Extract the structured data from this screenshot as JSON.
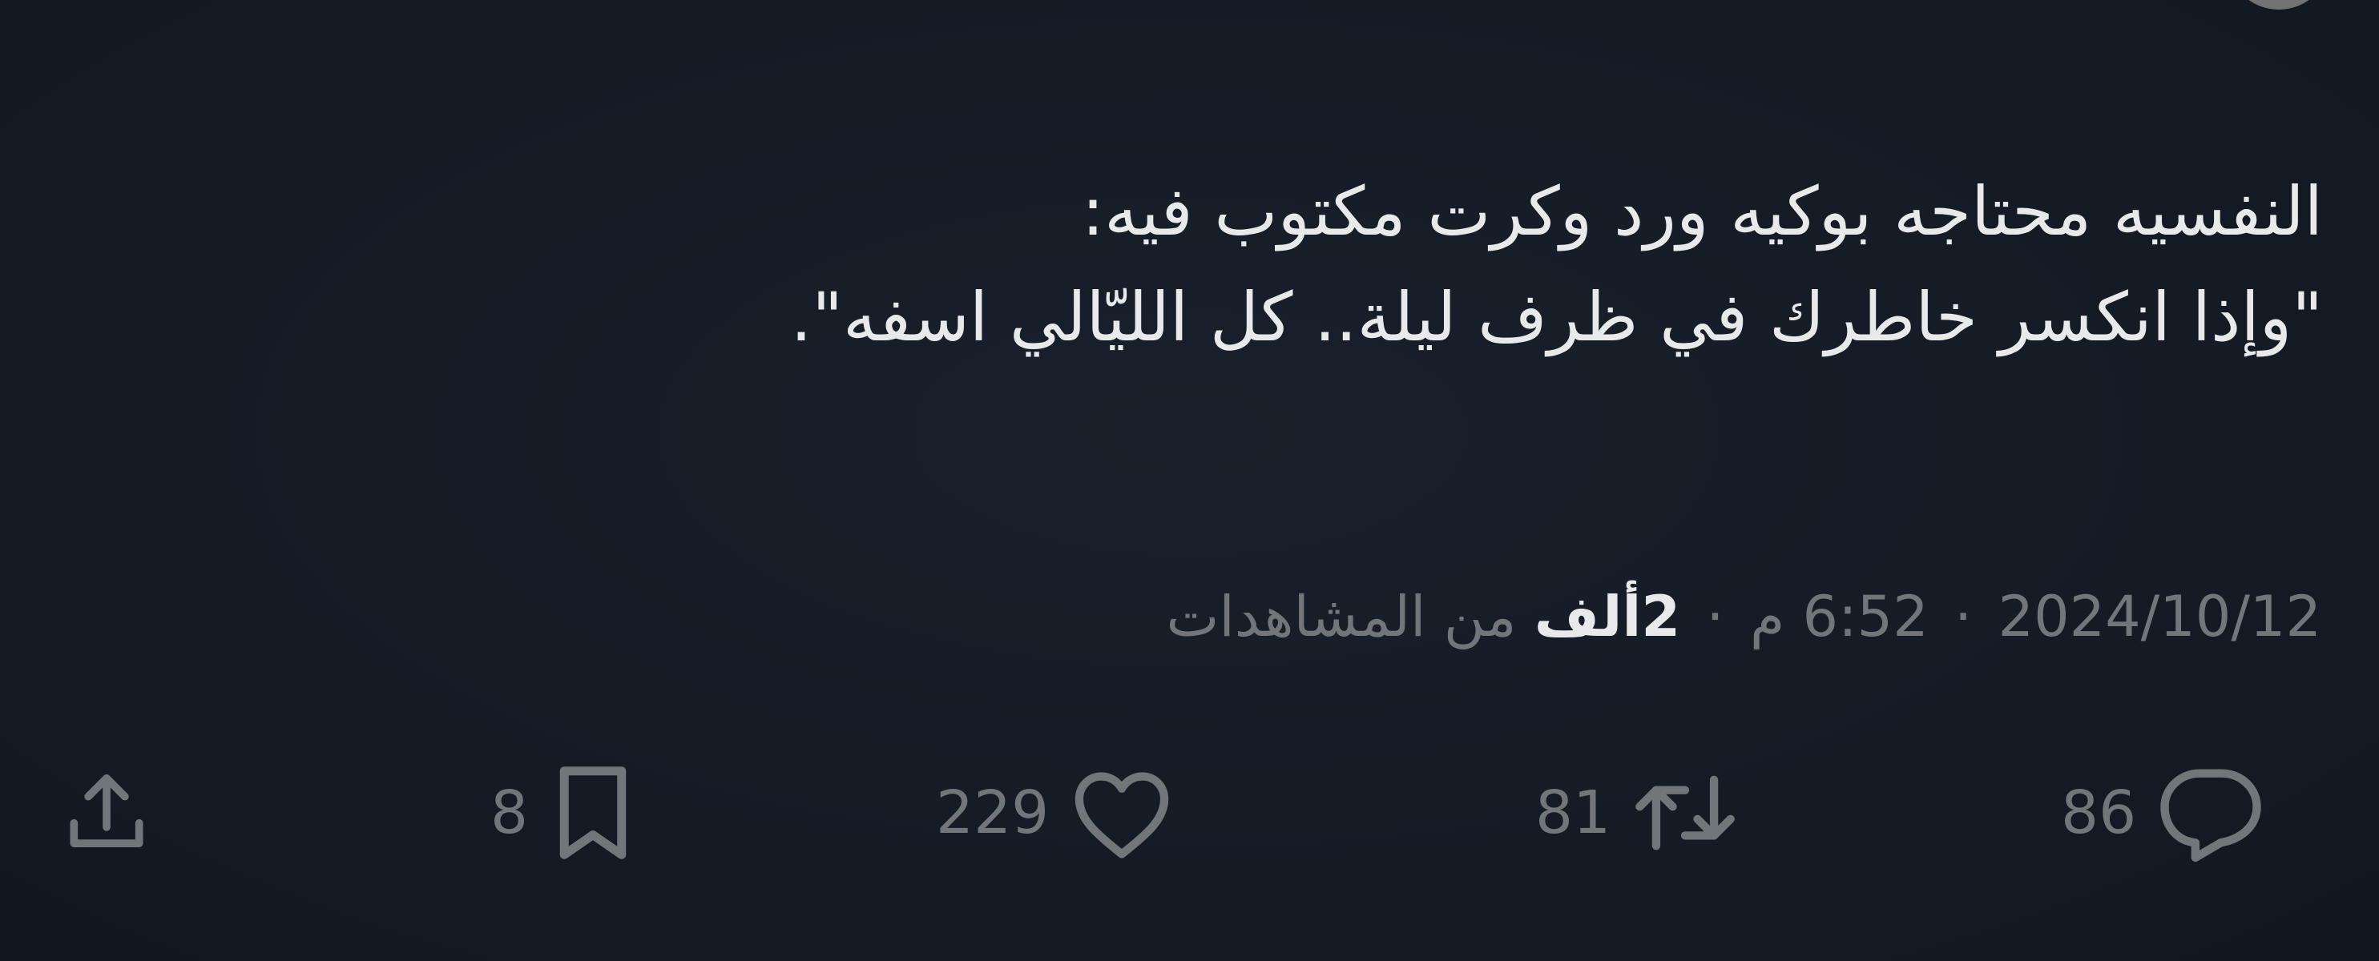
{
  "tweet": {
    "text_lines": [
      "النفسيه محتاجه بوكيه ورد وكرت مكتوب فيه:",
      "\"وإذا انكسر خاطرك في ظرف ليلة.. كل الليّالي اسفه\"."
    ]
  },
  "meta": {
    "date": "2024/10/12",
    "time": "6:52 م",
    "separator": "·",
    "views_count": "2ألف",
    "views_label": "من المشاهدات"
  },
  "actions": {
    "reply": {
      "count": "86",
      "icon": "reply-icon"
    },
    "retweet": {
      "count": "81",
      "icon": "retweet-icon"
    },
    "like": {
      "count": "229",
      "icon": "heart-icon"
    },
    "bookmark": {
      "count": "8",
      "icon": "bookmark-icon"
    },
    "share": {
      "icon": "share-icon"
    }
  },
  "colors": {
    "background": "#141b25",
    "text_primary": "#e7e9ea",
    "text_secondary": "#71767b"
  }
}
